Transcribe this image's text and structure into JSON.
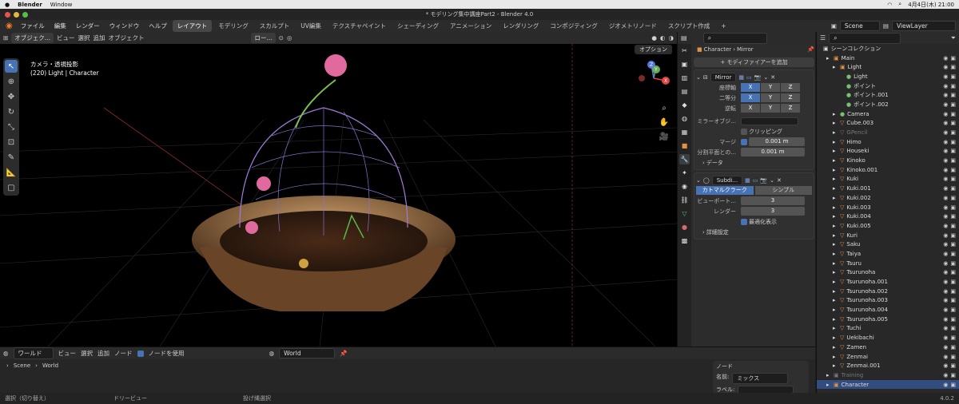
{
  "mac": {
    "apple": "",
    "app": "Blender",
    "window": "Window",
    "date": "4月4日(木) 21:00"
  },
  "title": "* モデリング集中講座Part2 - Blender 4.0",
  "menus": [
    "ファイル",
    "編集",
    "レンダー",
    "ウィンドウ",
    "ヘルプ"
  ],
  "workspaces": [
    {
      "label": "レイアウト",
      "active": true
    },
    {
      "label": "モデリング"
    },
    {
      "label": "スカルプト"
    },
    {
      "label": "UV編集"
    },
    {
      "label": "テクスチャペイント"
    },
    {
      "label": "シェーディング"
    },
    {
      "label": "アニメーション"
    },
    {
      "label": "レンダリング"
    },
    {
      "label": "コンポジティング"
    },
    {
      "label": "ジオメトリノード"
    },
    {
      "label": "スクリプト作成"
    }
  ],
  "add_tab": "+",
  "scene": "Scene",
  "view_layer": "ViewLayer",
  "viewport": {
    "mode": "オブジェク...",
    "menus": [
      "ビュー",
      "選択",
      "追加",
      "オブジェクト"
    ],
    "orientation": "ロー...",
    "options": "オプション",
    "info1": "カメラ・透視投影",
    "info2": "(220) Light | Character",
    "gizmo": {
      "x": "X",
      "y": "Y",
      "z": "Z"
    }
  },
  "properties": {
    "breadcrumb_obj": "Character",
    "breadcrumb_mod": "Mirror",
    "add_modifier": "モディファイアーを追加",
    "mirror": {
      "name": "Mirror",
      "axis_label": "座標軸",
      "bisect_label": "二等分",
      "flip_label": "逆転",
      "x": "X",
      "y": "Y",
      "z": "Z",
      "mirror_object_label": "ミラーオブジ...",
      "clipping": "クリッピング",
      "merge_label": "マージ",
      "merge_value": "0.001 m",
      "bisect_dist_label": "分割平面との...",
      "bisect_dist_value": "0.001 m",
      "data_panel": "データ"
    },
    "subdiv": {
      "name": "Subdi...",
      "catmull": "カトマルクラーク",
      "simple": "シンプル",
      "viewport_label": "ビューポート...",
      "viewport_value": "3",
      "render_label": "レンダー",
      "render_value": "3",
      "optimal": "最適化表示",
      "advanced": "詳細設定"
    }
  },
  "outliner": {
    "title": "シーンコレクション",
    "rows": [
      {
        "name": "Main",
        "indent": 1,
        "color": "orange"
      },
      {
        "name": "Light",
        "indent": 2,
        "color": "orange"
      },
      {
        "name": "Light",
        "indent": 3,
        "color": "green"
      },
      {
        "name": "ポイント",
        "indent": 3,
        "color": "green"
      },
      {
        "name": "ポイント.001",
        "indent": 3,
        "color": "green"
      },
      {
        "name": "ポイント.002",
        "indent": 3,
        "color": "green"
      },
      {
        "name": "Camera",
        "indent": 2,
        "color": "green"
      },
      {
        "name": "Cube.003",
        "indent": 2,
        "color": "orange"
      },
      {
        "name": "GPencil",
        "indent": 2,
        "color": "dim"
      },
      {
        "name": "Himo",
        "indent": 2,
        "color": "orange"
      },
      {
        "name": "Houseki",
        "indent": 2,
        "color": "orange"
      },
      {
        "name": "Kinoko",
        "indent": 2,
        "color": "orange"
      },
      {
        "name": "Kinoko.001",
        "indent": 2,
        "color": "orange"
      },
      {
        "name": "Kuki",
        "indent": 2,
        "color": "orange"
      },
      {
        "name": "Kuki.001",
        "indent": 2,
        "color": "orange"
      },
      {
        "name": "Kuki.002",
        "indent": 2,
        "color": "orange"
      },
      {
        "name": "Kuki.003",
        "indent": 2,
        "color": "orange"
      },
      {
        "name": "Kuki.004",
        "indent": 2,
        "color": "orange"
      },
      {
        "name": "Kuki.005",
        "indent": 2,
        "color": "orange"
      },
      {
        "name": "Kuri",
        "indent": 2,
        "color": "orange"
      },
      {
        "name": "Saku",
        "indent": 2,
        "color": "orange"
      },
      {
        "name": "Taiya",
        "indent": 2,
        "color": "orange"
      },
      {
        "name": "Tsuru",
        "indent": 2,
        "color": "orange"
      },
      {
        "name": "Tsurunoha",
        "indent": 2,
        "color": "orange"
      },
      {
        "name": "Tsurunoha.001",
        "indent": 2,
        "color": "orange"
      },
      {
        "name": "Tsurunoha.002",
        "indent": 2,
        "color": "orange"
      },
      {
        "name": "Tsurunoha.003",
        "indent": 2,
        "color": "orange"
      },
      {
        "name": "Tsurunoha.004",
        "indent": 2,
        "color": "orange"
      },
      {
        "name": "Tsurunoha.005",
        "indent": 2,
        "color": "orange"
      },
      {
        "name": "Tuchi",
        "indent": 2,
        "color": "orange"
      },
      {
        "name": "Uekibachi",
        "indent": 2,
        "color": "orange"
      },
      {
        "name": "Zamen",
        "indent": 2,
        "color": "orange"
      },
      {
        "name": "Zenmai",
        "indent": 2,
        "color": "orange"
      },
      {
        "name": "Zenmai.001",
        "indent": 2,
        "color": "orange"
      },
      {
        "name": "Training",
        "indent": 1,
        "color": "dim"
      },
      {
        "name": "Character",
        "indent": 1,
        "color": "orange"
      }
    ]
  },
  "node_editor": {
    "world_type": "ワールド",
    "menus": [
      "ビュー",
      "選択",
      "追加",
      "ノード"
    ],
    "use_nodes": "ノードを使用",
    "world": "World",
    "breadcrumb_scene": "Scene",
    "breadcrumb_world": "World",
    "node_panel": "ノード",
    "name_label": "名前:",
    "name_value": "ミックス",
    "label_label": "ラベル:"
  },
  "status": {
    "select": "選択（切り替え）",
    "pan": "ドリービュー",
    "lasso": "投げ縄選択",
    "version": "4.0.2"
  }
}
